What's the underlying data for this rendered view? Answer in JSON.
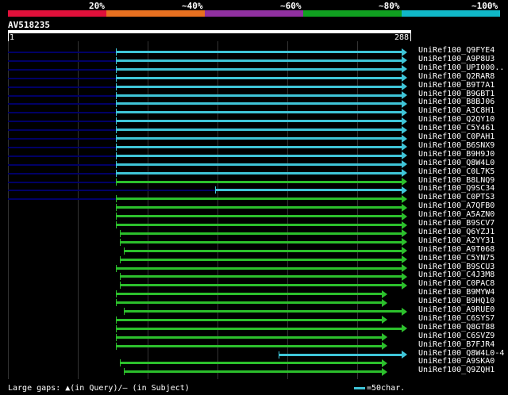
{
  "legend": {
    "segments": [
      {
        "color": "#e0103a"
      },
      {
        "color": "#e87020"
      },
      {
        "color": "#9030a0"
      },
      {
        "color": "#10a020"
      },
      {
        "color": "#10b8c8"
      }
    ],
    "labels": [
      "20%",
      "~40%",
      "~60%",
      "~80%",
      "~100%"
    ]
  },
  "query": {
    "id": "AV518235",
    "start_label": "1",
    "end_label": "288"
  },
  "colors": {
    "cyan": "#3fc5d8",
    "green": "#2cc02c",
    "dark": "#000066"
  },
  "hits": [
    {
      "label": "UniRef100_Q9FYE4",
      "color": "cyan",
      "start": 0.27,
      "end": 1.0,
      "dark": true
    },
    {
      "label": "UniRef100_A9P8U3",
      "color": "cyan",
      "start": 0.27,
      "end": 1.0,
      "dark": true
    },
    {
      "label": "UniRef100_UPI000..",
      "color": "cyan",
      "start": 0.27,
      "end": 1.0,
      "dark": true
    },
    {
      "label": "UniRef100_Q2RAR8",
      "color": "cyan",
      "start": 0.27,
      "end": 1.0,
      "dark": true
    },
    {
      "label": "UniRef100_B9T7A1",
      "color": "cyan",
      "start": 0.27,
      "end": 1.0,
      "dark": true
    },
    {
      "label": "UniRef100_B9GBT1",
      "color": "cyan",
      "start": 0.27,
      "end": 1.0,
      "dark": true
    },
    {
      "label": "UniRef100_B8BJ06",
      "color": "cyan",
      "start": 0.27,
      "end": 1.0,
      "dark": true
    },
    {
      "label": "UniRef100_A3C8H1",
      "color": "cyan",
      "start": 0.27,
      "end": 1.0,
      "dark": true
    },
    {
      "label": "UniRef100_Q2QY10",
      "color": "cyan",
      "start": 0.27,
      "end": 1.0,
      "dark": true
    },
    {
      "label": "UniRef100_C5Y461",
      "color": "cyan",
      "start": 0.27,
      "end": 1.0,
      "dark": true
    },
    {
      "label": "UniRef100_C0PAH1",
      "color": "cyan",
      "start": 0.27,
      "end": 1.0,
      "dark": true
    },
    {
      "label": "UniRef100_B6SNX9",
      "color": "cyan",
      "start": 0.27,
      "end": 1.0,
      "dark": true
    },
    {
      "label": "UniRef100_B9H9J0",
      "color": "cyan",
      "start": 0.27,
      "end": 1.0,
      "dark": true
    },
    {
      "label": "UniRef100_Q8W4L0",
      "color": "cyan",
      "start": 0.27,
      "end": 1.0,
      "dark": true
    },
    {
      "label": "UniRef100_C0L7K5",
      "color": "cyan",
      "start": 0.27,
      "end": 1.0,
      "dark": true
    },
    {
      "label": "UniRef100_B8LNQ9",
      "color": "green",
      "start": 0.27,
      "end": 1.0,
      "dark": true
    },
    {
      "label": "UniRef100_Q9SC34",
      "color": "cyan",
      "start": 0.52,
      "end": 1.0,
      "dark": true
    },
    {
      "label": "UniRef100_C0PTS3",
      "color": "green",
      "start": 0.27,
      "end": 1.0,
      "dark": true
    },
    {
      "label": "UniRef100_A7QFB0",
      "color": "green",
      "start": 0.27,
      "end": 1.0,
      "dark": false
    },
    {
      "label": "UniRef100_A5AZN0",
      "color": "green",
      "start": 0.27,
      "end": 1.0,
      "dark": false
    },
    {
      "label": "UniRef100_B9SCV7",
      "color": "green",
      "start": 0.27,
      "end": 1.0,
      "dark": false
    },
    {
      "label": "UniRef100_Q6YZJ1",
      "color": "green",
      "start": 0.28,
      "end": 1.0,
      "dark": false
    },
    {
      "label": "UniRef100_A2YY31",
      "color": "green",
      "start": 0.28,
      "end": 1.0,
      "dark": false
    },
    {
      "label": "UniRef100_A9T068",
      "color": "green",
      "start": 0.29,
      "end": 1.0,
      "dark": false
    },
    {
      "label": "UniRef100_C5YN75",
      "color": "green",
      "start": 0.28,
      "end": 1.0,
      "dark": false
    },
    {
      "label": "UniRef100_B9SCU3",
      "color": "green",
      "start": 0.27,
      "end": 1.0,
      "dark": false
    },
    {
      "label": "UniRef100_C4J3M8",
      "color": "green",
      "start": 0.28,
      "end": 1.0,
      "dark": false
    },
    {
      "label": "UniRef100_C0PAC8",
      "color": "green",
      "start": 0.28,
      "end": 1.0,
      "dark": false
    },
    {
      "label": "UniRef100_B9MYW4",
      "color": "green",
      "start": 0.27,
      "end": 0.95,
      "dark": false
    },
    {
      "label": "UniRef100_B9HQ10",
      "color": "green",
      "start": 0.27,
      "end": 0.95,
      "dark": false
    },
    {
      "label": "UniRef100_A9RUE0",
      "color": "green",
      "start": 0.29,
      "end": 1.0,
      "dark": false
    },
    {
      "label": "UniRef100_C6SYS7",
      "color": "green",
      "start": 0.27,
      "end": 0.95,
      "dark": false
    },
    {
      "label": "UniRef100_Q8GT88",
      "color": "green",
      "start": 0.27,
      "end": 1.0,
      "dark": false
    },
    {
      "label": "UniRef100_C6SVZ9",
      "color": "green",
      "start": 0.27,
      "end": 0.95,
      "dark": false
    },
    {
      "label": "UniRef100_B7FJR4",
      "color": "green",
      "start": 0.27,
      "end": 0.95,
      "dark": false
    },
    {
      "label": "UniRef100_Q8W4L0-4",
      "color": "cyan",
      "start": 0.68,
      "end": 1.0,
      "dark": false
    },
    {
      "label": "UniRef100_A9SKA0",
      "color": "green",
      "start": 0.28,
      "end": 0.95,
      "dark": false
    },
    {
      "label": "UniRef100_Q9ZQH1",
      "color": "green",
      "start": 0.29,
      "end": 0.95,
      "dark": false
    }
  ],
  "footer": {
    "gaps_text": "Large gaps: ▲(in Query)/— (in Subject)",
    "scale_text": "=50char."
  }
}
